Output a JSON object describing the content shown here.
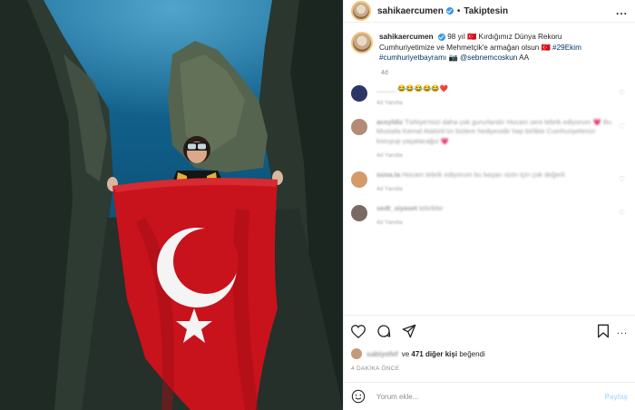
{
  "header": {
    "username": "sahikaercumen",
    "separator": "•",
    "follow_label": "Takiptesin",
    "more_label": "..."
  },
  "caption": {
    "username": "sahikaercumen",
    "text_1": "98 yıl 🇹🇷 Kırdığımız Dünya Rekoru Cumhuriyetimize ve Mehmetçik'e armağan olsun 🇹🇷 ",
    "hashtag_1": "#29Ekim",
    "hashtag_2": "#cumhuriyetbayramı",
    "camera": "📷",
    "mention": "@sebnemcoskun",
    "credit": "AA",
    "age": "4d"
  },
  "comments": [
    {
      "user": "_____",
      "text": "😂😂😂😂😂❤️",
      "meta": "4d   Yanıtla",
      "blurred": true
    },
    {
      "user": "aceyldiz",
      "text": "Türkiye'mizi daha çok gururlandır Hocam seni tebrik ediyorum 💗 Bu Mustafa Kemal Atatürk'ün bizlere hediyesidir hep birlikte Cumhuriyetimizi koruyup yaşatacağız 💗",
      "meta": "4d   Yanıtla",
      "blurred": true
    },
    {
      "user": "suna.ta",
      "text": "Hocam tebrik ediyorum bu başarı sizin için çok değerli",
      "meta": "4d   Yanıtla",
      "blurred": true
    },
    {
      "user": "sedt_siyaset",
      "text": "tebrikler",
      "meta": "4d   Yanıtla",
      "blurred": true
    }
  ],
  "likes": {
    "liker": "sabiyefef",
    "connector": "ve",
    "count": "471 diğer kişi",
    "suffix": "beğendi"
  },
  "time_ago": "4 DAKİKA ÖNCE",
  "comment_box": {
    "placeholder": "Yorum ekle...",
    "post_label": "Paylaş"
  },
  "colors": {
    "link": "#00376b",
    "verified": "#3897f0",
    "flag_red": "#d2141d"
  }
}
